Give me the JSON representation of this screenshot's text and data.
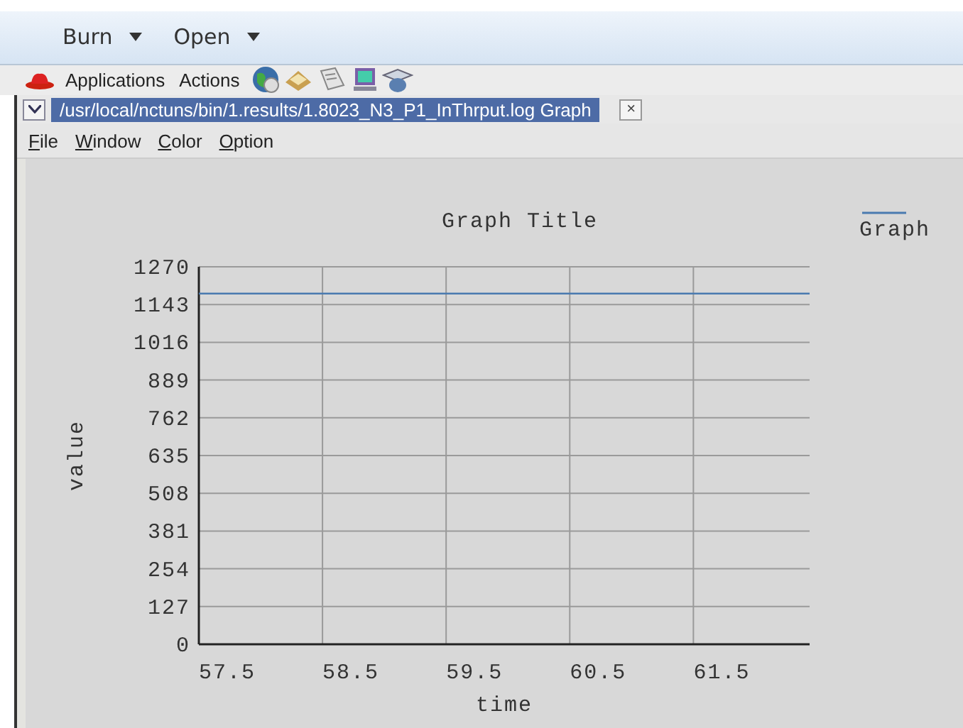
{
  "panel": {
    "menus": [
      {
        "label": "Burn"
      },
      {
        "label": "Open"
      }
    ]
  },
  "launcher": {
    "items": [
      {
        "label": "Applications"
      },
      {
        "label": "Actions"
      }
    ]
  },
  "window": {
    "title": "/usr/local/nctuns/bin/1.results/1.8023_N3_P1_InThrput.log Graph",
    "close": "×"
  },
  "menu": [
    {
      "label": "File"
    },
    {
      "label": "Window"
    },
    {
      "label": "Color"
    },
    {
      "label": "Option"
    }
  ],
  "chart": {
    "chart_data": {
      "type": "line",
      "title": "Graph Title",
      "xlabel": "time",
      "ylabel": "value",
      "xlim": [
        57.27,
        62.21
      ],
      "ylim": [
        0,
        1270
      ],
      "grid": true,
      "xticks": [
        57.5,
        58.5,
        59.5,
        60.5,
        61.5
      ],
      "yticks": [
        0,
        127,
        254,
        381,
        508,
        635,
        762,
        889,
        1016,
        1143,
        1270
      ],
      "x": [
        57.27,
        62.21
      ],
      "series": [
        {
          "name": "Graph",
          "color": "#4a7ab0",
          "values": [
            1180,
            1180
          ]
        }
      ]
    }
  }
}
